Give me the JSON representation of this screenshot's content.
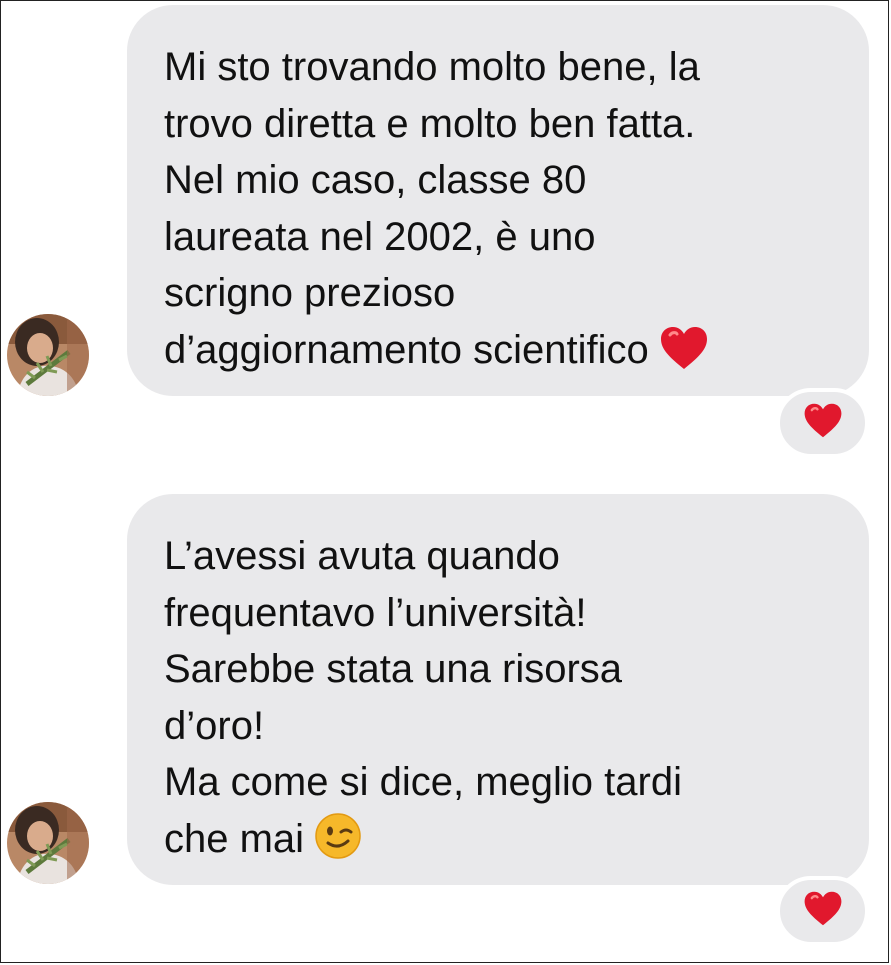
{
  "messages": [
    {
      "lines": [
        "Mi sto trovando molto bene, la",
        "trovo diretta e molto ben fatta.",
        "Nel mio caso, classe 80",
        "laureata nel 2002, è uno",
        "scrigno prezioso",
        "d’aggiornamento scientifico"
      ],
      "trailing_emoji": "heart-icon",
      "reaction": "heart-icon"
    },
    {
      "lines": [
        "L’avessi avuta quando",
        "frequentavo l’università!",
        "Sarebbe stata una risorsa",
        "d’oro!",
        "Ma come si dice, meglio tardi",
        "che mai"
      ],
      "trailing_emoji": "winking-face-icon",
      "reaction": "heart-icon"
    }
  ],
  "colors": {
    "bubble_bg": "#e9e9eb",
    "text": "#111111",
    "heart": "#e1182d",
    "wink_face": "#f6b82a"
  }
}
